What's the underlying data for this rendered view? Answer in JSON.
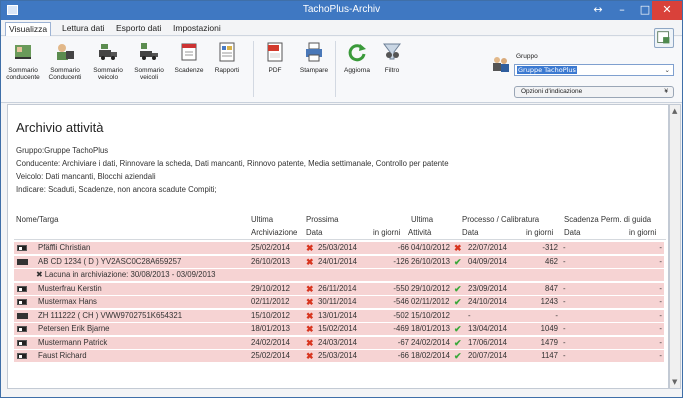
{
  "window": {
    "title": "TachoPlus-Archiv",
    "restore": "↔",
    "minimize": "–",
    "maximize": "□",
    "close": "✕"
  },
  "menu": [
    "Visualizza",
    "Lettura dati",
    "Esporto dati",
    "Impostazioni"
  ],
  "ribbon": {
    "buttons": [
      {
        "label": "Sommario\nconducente",
        "icon": "driver-summary-icon"
      },
      {
        "label": "Sommario\nConducenti",
        "icon": "drivers-summary-icon"
      },
      {
        "label": "Sommario\nveicolo",
        "icon": "vehicle-summary-icon"
      },
      {
        "label": "Sommario\nveicoli",
        "icon": "vehicles-summary-icon"
      },
      {
        "label": "Scadenze",
        "icon": "deadlines-icon"
      },
      {
        "label": "Rapporti",
        "icon": "reports-icon"
      },
      {
        "label": "PDF",
        "icon": "pdf-icon"
      },
      {
        "label": "Stampare",
        "icon": "printer-icon"
      },
      {
        "label": "Aggiorna",
        "icon": "refresh-icon"
      },
      {
        "label": "Filtro",
        "icon": "filter-icon"
      }
    ],
    "group_label": "Gruppo",
    "group_value": "Gruppe TachoPlus",
    "options_label": "Opzioni d'indicazione"
  },
  "content": {
    "title": "Archivio attività",
    "lines": [
      "Gruppo:Gruppe TachoPlus",
      "Conducente: Archiviare i dati, Rinnovare la scheda, Dati mancanti, Rinnovo patente, Media settimanale, Controllo per patente",
      "Veicolo: Dati mancanti, Blocchi aziendali",
      "Indicare: Scaduti, Scadenze, non ancora scadute Compiti;"
    ],
    "headers": {
      "name": "Nome/Targa",
      "ultima1": "Ultima",
      "archiviazione": "Archiviazione",
      "prossima": "Prossima",
      "data1": "Data",
      "in_giorni1": "in giorni",
      "ultima2": "Ultima",
      "attivita": "Attività",
      "processo": "Processo / Calibratura",
      "data2": "Data",
      "in_giorni2": "in giorni",
      "scadenza": "Scadenza Perm. di guida",
      "data3": "Data",
      "in_giorni3": "in giorni"
    },
    "rows": [
      {
        "icon": "driver-card-icon",
        "name": "Pfäffli Christian",
        "ultima": "25/02/2014",
        "prossima_mark": "✖",
        "prossima": "25/03/2014",
        "giorni1": "-66",
        "attivita": "04/10/2012",
        "proc_mark": "✖",
        "proc": "22/07/2014",
        "giorni2": "-312",
        "scad": "-",
        "giorni3": "-"
      },
      {
        "icon": "vehicle-card-icon",
        "name": "AB CD 1234 ( D ) YV2ASC0C28A659257",
        "ultima": "26/10/2013",
        "prossima_mark": "✖",
        "prossima": "24/01/2014",
        "giorni1": "-126",
        "attivita": "26/10/2013",
        "proc_mark": "✔",
        "proc": "04/09/2014",
        "giorni2": "462",
        "scad": "-",
        "giorni3": "-"
      },
      {
        "icon": "",
        "name": "✖ Lacuna in archiviazione: 30/08/2013 - 03/09/2013",
        "ultima": "",
        "prossima_mark": "",
        "prossima": "",
        "giorni1": "",
        "attivita": "",
        "proc_mark": "",
        "proc": "",
        "giorni2": "",
        "scad": "",
        "giorni3": ""
      },
      {
        "icon": "driver-card-icon",
        "name": "Musterfrau Kerstin",
        "ultima": "29/10/2012",
        "prossima_mark": "✖",
        "prossima": "26/11/2014",
        "giorni1": "-550",
        "attivita": "29/10/2012",
        "proc_mark": "✔",
        "proc": "23/09/2014",
        "giorni2": "847",
        "scad": "-",
        "giorni3": "-"
      },
      {
        "icon": "driver-card-icon",
        "name": "Mustermax Hans",
        "ultima": "02/11/2012",
        "prossima_mark": "✖",
        "prossima": "30/11/2014",
        "giorni1": "-546",
        "attivita": "02/11/2012",
        "proc_mark": "✔",
        "proc": "24/10/2014",
        "giorni2": "1243",
        "scad": "-",
        "giorni3": "-"
      },
      {
        "icon": "vehicle-card-icon",
        "name": "ZH 111222 ( CH ) VWW9702751K654321",
        "ultima": "15/10/2012",
        "prossima_mark": "✖",
        "prossima": "13/01/2014",
        "giorni1": "-502",
        "attivita": "15/10/2012",
        "proc_mark": "",
        "proc": "-",
        "giorni2": "-",
        "scad": "",
        "giorni3": "-"
      },
      {
        "icon": "driver-card-icon",
        "name": "Petersen Erik Bjarne",
        "ultima": "18/01/2013",
        "prossima_mark": "✖",
        "prossima": "15/02/2014",
        "giorni1": "-469",
        "attivita": "18/01/2013",
        "proc_mark": "✔",
        "proc": "13/04/2014",
        "giorni2": "1049",
        "scad": "-",
        "giorni3": "-"
      },
      {
        "icon": "driver-card-icon",
        "name": "Mustermann Patrick",
        "ultima": "24/02/2014",
        "prossima_mark": "✖",
        "prossima": "24/03/2014",
        "giorni1": "-67",
        "attivita": "24/02/2014",
        "proc_mark": "✔",
        "proc": "17/06/2014",
        "giorni2": "1479",
        "scad": "-",
        "giorni3": "-"
      },
      {
        "icon": "driver-card-icon",
        "name": "Faust Richard",
        "ultima": "25/02/2014",
        "prossima_mark": "✖",
        "prossima": "25/03/2014",
        "giorni1": "-66",
        "attivita": "18/02/2014",
        "proc_mark": "✔",
        "proc": "20/07/2014",
        "giorni2": "1147",
        "scad": "-",
        "giorni3": "-"
      }
    ]
  },
  "colors": {
    "titlebar": "#3f78c2",
    "row_alert": "#f6d3d3",
    "cross": "#d8351f",
    "check": "#3aa83a",
    "close": "#d9413a"
  }
}
